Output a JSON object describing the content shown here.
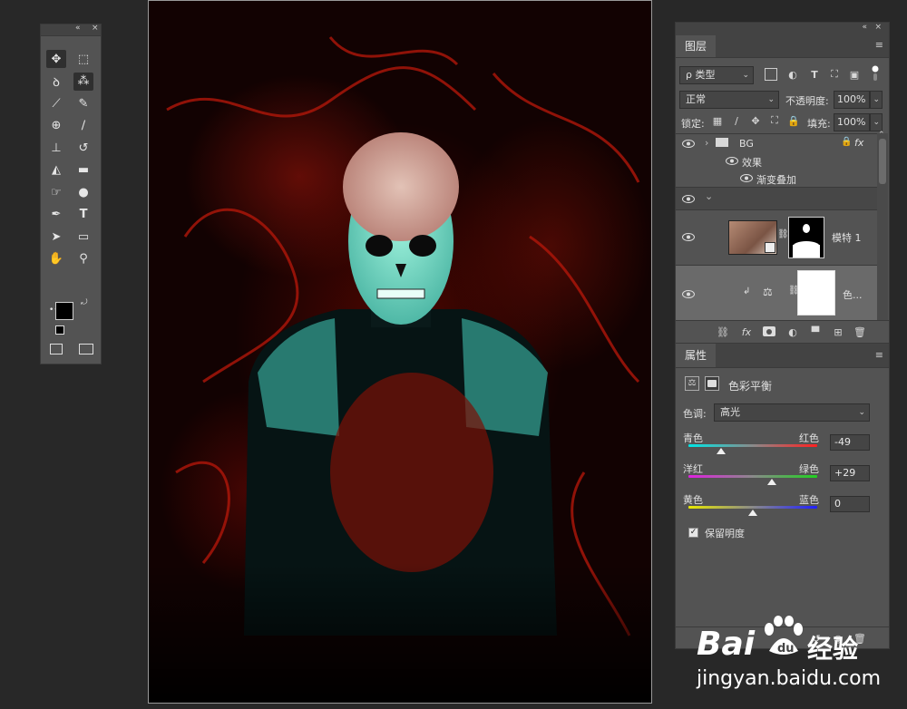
{
  "tools_panel": {
    "header_glyphs": [
      "«",
      "×"
    ],
    "tools": [
      {
        "name": "move-tool-icon",
        "glyph": "✥",
        "active": true
      },
      {
        "name": "marquee-tool-icon",
        "glyph": "⬚",
        "active": false
      },
      {
        "name": "lasso-tool-icon",
        "glyph": "ꝺ",
        "active": false
      },
      {
        "name": "magic-wand-tool-icon",
        "glyph": "⁂",
        "active": true
      },
      {
        "name": "crop-tool-icon",
        "glyph": "⟋",
        "active": false
      },
      {
        "name": "eyedropper-tool-icon",
        "glyph": "✎",
        "active": false
      },
      {
        "name": "healing-brush-tool-icon",
        "glyph": "⊕",
        "active": false
      },
      {
        "name": "brush-tool-icon",
        "glyph": "∕",
        "active": false
      },
      {
        "name": "clone-stamp-tool-icon",
        "glyph": "⊥",
        "active": false
      },
      {
        "name": "history-brush-tool-icon",
        "glyph": "↺",
        "active": false
      },
      {
        "name": "eraser-tool-icon",
        "glyph": "◭",
        "active": false
      },
      {
        "name": "gradient-tool-icon",
        "glyph": "▬",
        "active": false
      },
      {
        "name": "smudge-tool-icon",
        "glyph": "☞",
        "active": false
      },
      {
        "name": "dodge-tool-icon",
        "glyph": "●",
        "active": false
      },
      {
        "name": "pen-tool-icon",
        "glyph": "✒",
        "active": false
      },
      {
        "name": "type-tool-icon",
        "glyph": "T",
        "active": false
      },
      {
        "name": "path-selection-tool-icon",
        "glyph": "➤",
        "active": false
      },
      {
        "name": "rectangle-tool-icon",
        "glyph": "▭",
        "active": false
      },
      {
        "name": "hand-tool-icon",
        "glyph": "✋",
        "active": false
      },
      {
        "name": "zoom-tool-icon",
        "glyph": "⚲",
        "active": false
      },
      {
        "name": "more-tools-icon",
        "glyph": "•••",
        "active": false
      }
    ],
    "foreground_color": "#000000",
    "background_color": "#ffffff"
  },
  "layers_panel": {
    "header_glyphs": [
      "«",
      "×"
    ],
    "tab_label": "图层",
    "menu_glyph": "≡",
    "filter_kind": "ρ 类型",
    "blend_mode": "正常",
    "opacity_label": "不透明度:",
    "opacity_value": "100%",
    "lock_label": "锁定:",
    "fill_label": "填充:",
    "fill_value": "100%",
    "layers": [
      {
        "name": "BG",
        "type": "group",
        "visible": true,
        "lock": "🔒",
        "fx": "fx"
      },
      {
        "name": "效果",
        "type": "effects",
        "visible": true
      },
      {
        "name": "渐变叠加",
        "type": "effect",
        "visible": true
      },
      {
        "name": "",
        "type": "group-open",
        "visible": true
      },
      {
        "name": "模特 1",
        "type": "layer",
        "visible": true
      },
      {
        "name": "色...",
        "type": "adjustment",
        "visible": true
      }
    ],
    "footer_icons": [
      "link-icon",
      "fx-icon",
      "mask-icon",
      "adjustment-icon",
      "folder-icon",
      "new-layer-icon",
      "trash-icon"
    ],
    "footer_fx": "fx"
  },
  "properties_panel": {
    "tab_label": "属性",
    "menu_glyph": "≡",
    "adjustment_title": "色彩平衡",
    "tone_label": "色调:",
    "tone_value": "高光",
    "sliders": [
      {
        "left": "青色",
        "right": "红色",
        "value": "-49",
        "fraction": 0.255,
        "colors": [
          "#00e5e5",
          "#ff2020"
        ]
      },
      {
        "left": "洋红",
        "right": "绿色",
        "value": "+29",
        "fraction": 0.645,
        "colors": [
          "#e020e0",
          "#20d020"
        ]
      },
      {
        "left": "黄色",
        "right": "蓝色",
        "value": "0",
        "fraction": 0.5,
        "colors": [
          "#e8e800",
          "#2020ff"
        ]
      }
    ],
    "preserve_luminosity_label": "保留明度",
    "preserve_luminosity": true
  },
  "watermark": {
    "brand": "Bai",
    "brand_suffix": "经验",
    "url": "jingyan.baidu.com"
  }
}
